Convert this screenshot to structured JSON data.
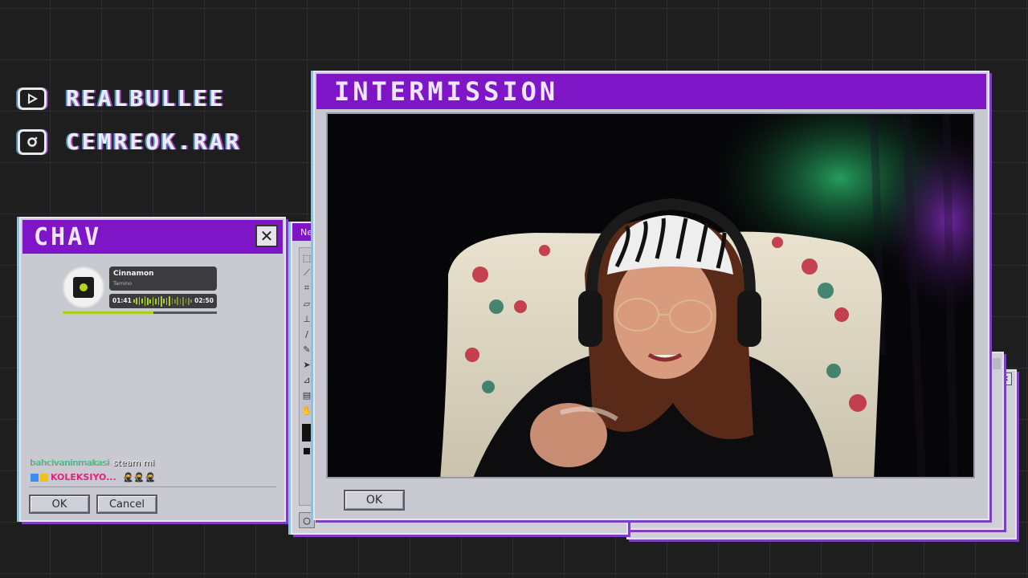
{
  "socials": [
    {
      "icon": "youtube-icon",
      "handle": "REALBULLEE"
    },
    {
      "icon": "instagram-icon",
      "handle": "CEMREOK.RAR"
    }
  ],
  "main_window": {
    "title": "INTERMISSION",
    "ok_label": "OK"
  },
  "chat_window": {
    "title": "CHAV",
    "ok_label": "OK",
    "cancel_label": "Cancel",
    "now_playing": {
      "song": "Cinnamon",
      "artist": "Tamino",
      "elapsed": "01:41",
      "duration": "02:50",
      "progress": 0.59
    },
    "messages": [
      {
        "user": "bahcivaninmakasi",
        "text": "steam mi"
      },
      {
        "user": "KOLEKSIYO...",
        "text": ""
      }
    ]
  },
  "paint_window": {
    "title_fragment": "Ne"
  },
  "colors": {
    "titlebar": "#7e16c8",
    "window_bg": "#c9c9d2",
    "accent_cyan": "#77c7f0",
    "accent_purple": "#7d3fbd",
    "chat_user_1": "#3fd07f",
    "chat_user_2": "#e0237a",
    "progress_green": "#a9d21c"
  }
}
